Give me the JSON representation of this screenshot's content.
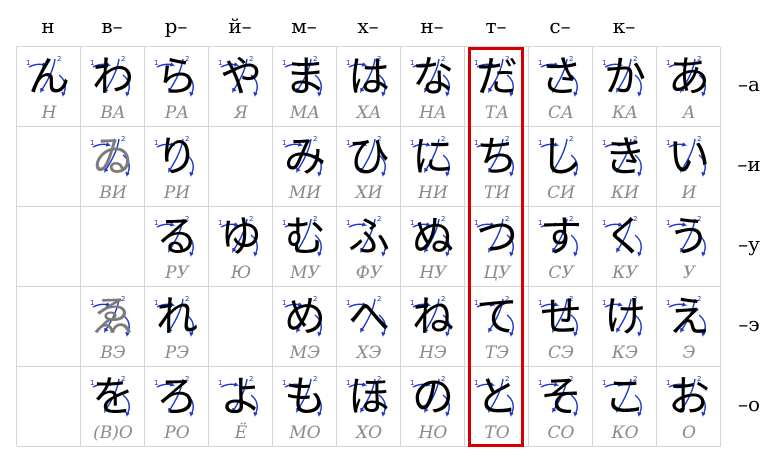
{
  "columns": [
    "н",
    "в–",
    "р–",
    "й–",
    "м–",
    "х–",
    "н–",
    "т–",
    "с–",
    "к–",
    ""
  ],
  "rows": [
    "–а",
    "–и",
    "–у",
    "–э",
    "–о"
  ],
  "highlighted_column": "т–",
  "cells": [
    [
      {
        "kana": "ん",
        "reading": "Н"
      },
      {
        "kana": "わ",
        "reading": "ВА"
      },
      {
        "kana": "ら",
        "reading": "РА"
      },
      {
        "kana": "や",
        "reading": "Я"
      },
      {
        "kana": "ま",
        "reading": "МА"
      },
      {
        "kana": "は",
        "reading": "ХА"
      },
      {
        "kana": "な",
        "reading": "НА"
      },
      {
        "kana": "だ",
        "reading": "ТА"
      },
      {
        "kana": "さ",
        "reading": "СА"
      },
      {
        "kana": "か",
        "reading": "КА"
      },
      {
        "kana": "あ",
        "reading": "А"
      }
    ],
    [
      {
        "kana": "",
        "reading": ""
      },
      {
        "kana": "ゐ",
        "reading": "ВИ",
        "archaic": true
      },
      {
        "kana": "り",
        "reading": "РИ"
      },
      {
        "kana": "",
        "reading": ""
      },
      {
        "kana": "み",
        "reading": "МИ"
      },
      {
        "kana": "ひ",
        "reading": "ХИ"
      },
      {
        "kana": "に",
        "reading": "НИ"
      },
      {
        "kana": "ち",
        "reading": "ТИ"
      },
      {
        "kana": "し",
        "reading": "СИ"
      },
      {
        "kana": "き",
        "reading": "КИ"
      },
      {
        "kana": "い",
        "reading": "И"
      }
    ],
    [
      {
        "kana": "",
        "reading": ""
      },
      {
        "kana": "",
        "reading": ""
      },
      {
        "kana": "る",
        "reading": "РУ"
      },
      {
        "kana": "ゆ",
        "reading": "Ю"
      },
      {
        "kana": "む",
        "reading": "МУ"
      },
      {
        "kana": "ふ",
        "reading": "ФУ"
      },
      {
        "kana": "ぬ",
        "reading": "НУ"
      },
      {
        "kana": "つ",
        "reading": "ЦУ"
      },
      {
        "kana": "す",
        "reading": "СУ"
      },
      {
        "kana": "く",
        "reading": "КУ"
      },
      {
        "kana": "う",
        "reading": "У"
      }
    ],
    [
      {
        "kana": "",
        "reading": ""
      },
      {
        "kana": "ゑ",
        "reading": "ВЭ",
        "archaic": true
      },
      {
        "kana": "れ",
        "reading": "РЭ"
      },
      {
        "kana": "",
        "reading": ""
      },
      {
        "kana": "め",
        "reading": "МЭ"
      },
      {
        "kana": "へ",
        "reading": "ХЭ"
      },
      {
        "kana": "ね",
        "reading": "НЭ"
      },
      {
        "kana": "て",
        "reading": "ТЭ"
      },
      {
        "kana": "せ",
        "reading": "СЭ"
      },
      {
        "kana": "け",
        "reading": "КЭ"
      },
      {
        "kana": "え",
        "reading": "Э"
      }
    ],
    [
      {
        "kana": "",
        "reading": ""
      },
      {
        "kana": "を",
        "reading": "(В)О"
      },
      {
        "kana": "ろ",
        "reading": "РО"
      },
      {
        "kana": "よ",
        "reading": "Ё"
      },
      {
        "kana": "も",
        "reading": "МО"
      },
      {
        "kana": "ほ",
        "reading": "ХО"
      },
      {
        "kana": "の",
        "reading": "НО"
      },
      {
        "kana": "と",
        "reading": "ТО"
      },
      {
        "kana": "そ",
        "reading": "СО"
      },
      {
        "kana": "こ",
        "reading": "КО"
      },
      {
        "kana": "お",
        "reading": "О"
      }
    ]
  ],
  "colors": {
    "grid_line": "#d4d4d4",
    "stroke_arrow": "#1a36c9",
    "highlight": "#d40000",
    "reading": "#8a8a8a",
    "archaic": "#7c7c7c"
  }
}
